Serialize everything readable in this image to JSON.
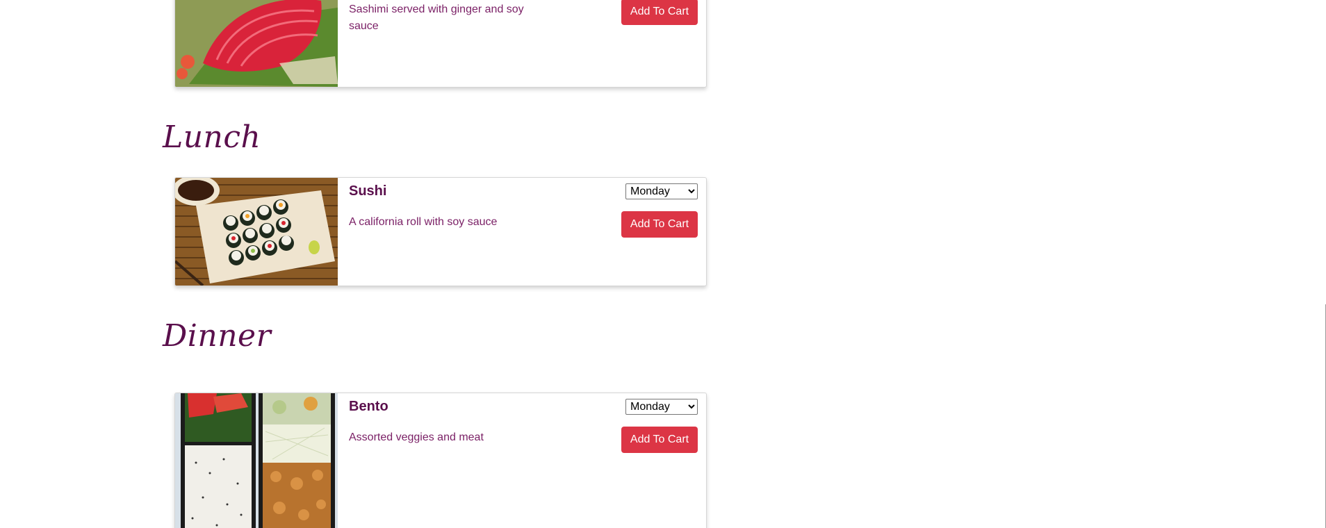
{
  "sections": {
    "lunch_heading": "Lunch",
    "dinner_heading": "Dinner"
  },
  "cards": {
    "sashimi": {
      "description": "Sashimi served with ginger and soy sauce",
      "add_label": "Add To Cart"
    },
    "sushi": {
      "title": "Sushi",
      "description": "A california roll with soy sauce",
      "selected_day": "Monday",
      "add_label": "Add To Cart"
    },
    "bento": {
      "title": "Bento",
      "description": "Assorted veggies and meat",
      "selected_day": "Monday",
      "add_label": "Add To Cart"
    }
  },
  "colors": {
    "accent_button": "#dc3545",
    "heading_text": "#5a0f4c",
    "body_text": "#7a1f65"
  }
}
